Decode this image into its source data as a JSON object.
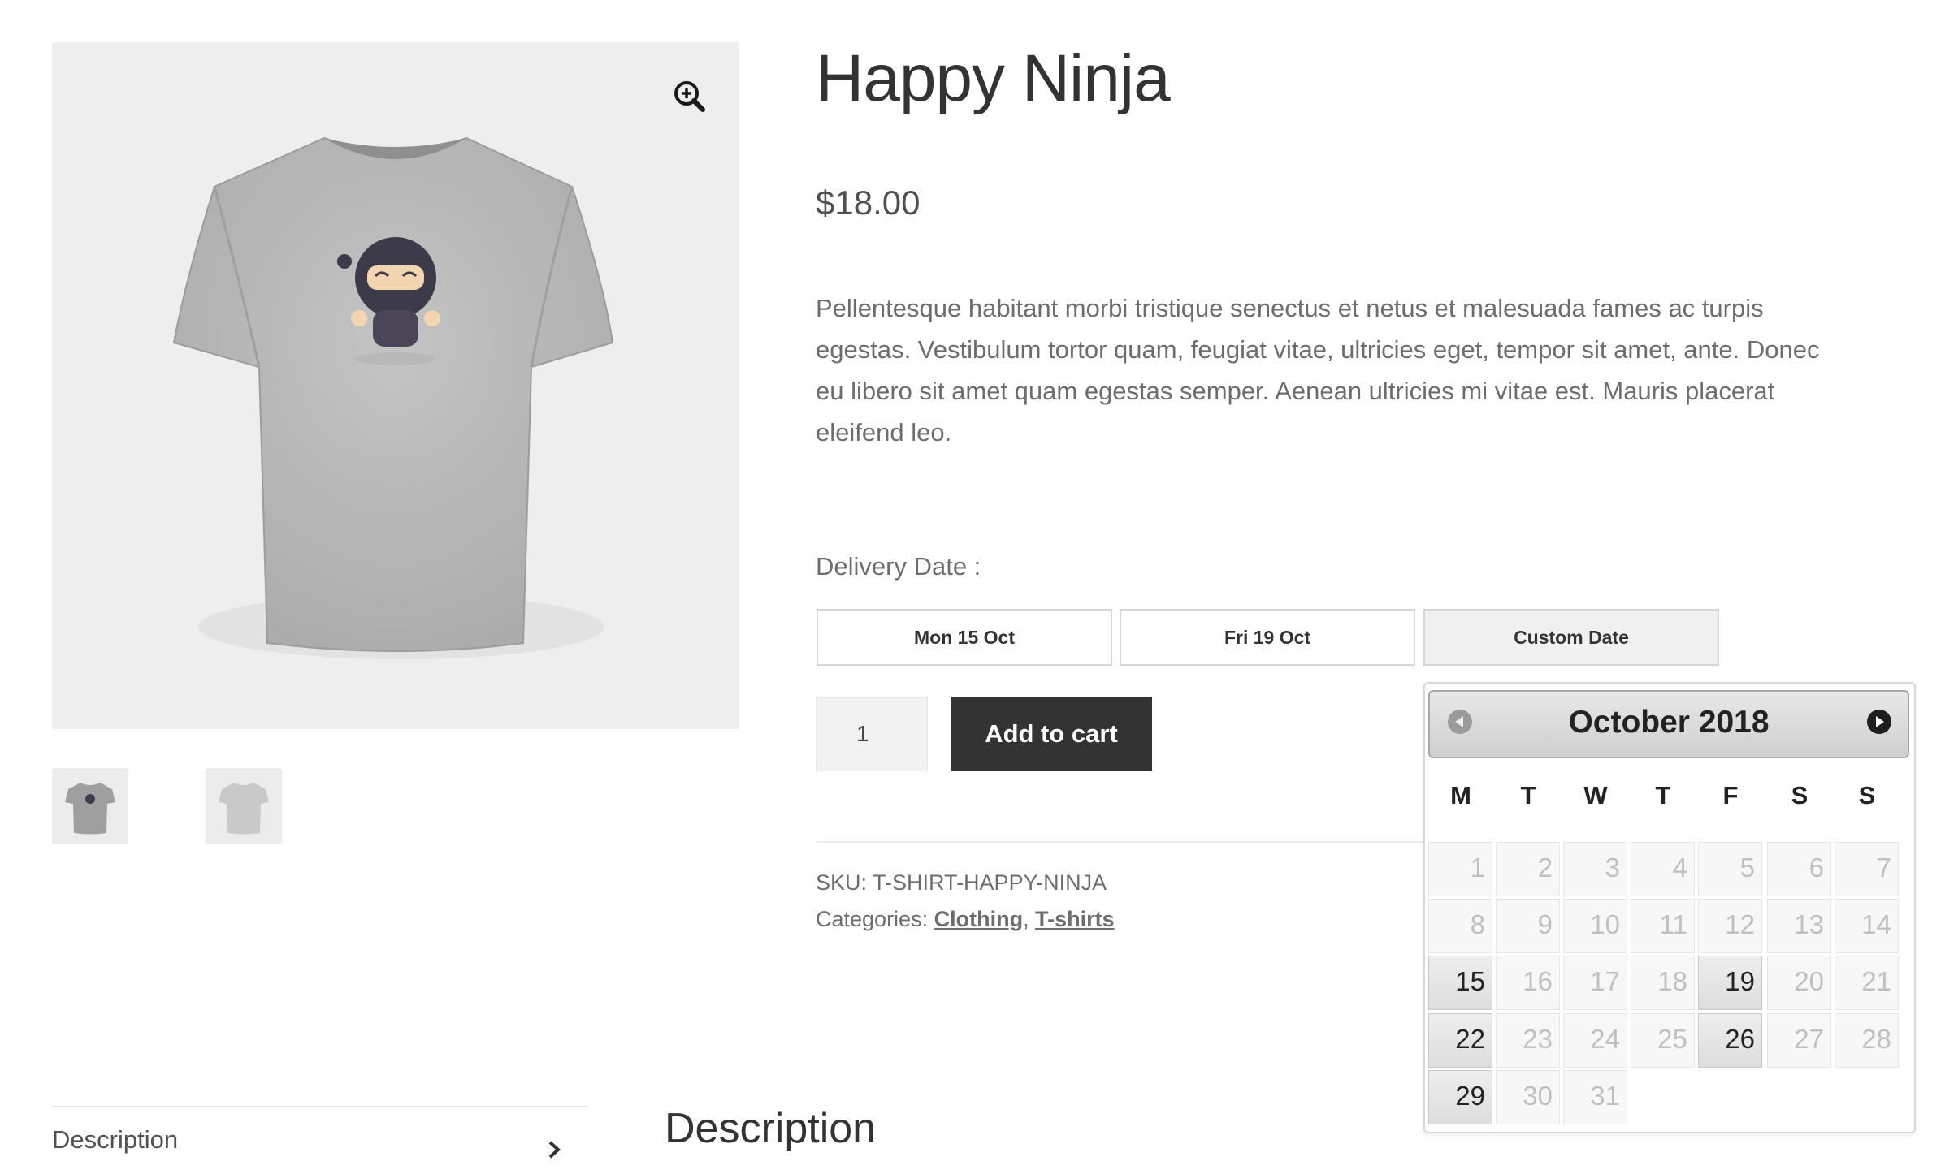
{
  "gallery": {
    "zoom_icon": "magnifier-plus-icon",
    "main_image_alt": "Happy Ninja t-shirt",
    "thumbnails": [
      "ninja-shirt-front-thumb",
      "shirt-back-thumb"
    ]
  },
  "product": {
    "title": "Happy Ninja",
    "price": "$18.00",
    "description": "Pellentesque habitant morbi tristique senectus et netus et malesuada fames ac turpis egestas. Vestibulum tortor quam, feugiat vitae, ultricies eget, tempor sit amet, ante. Donec eu libero sit amet quam egestas semper. Aenean ultricies mi vitae est. Mauris placerat eleifend leo."
  },
  "delivery": {
    "label": "Delivery Date :",
    "options": [
      "Mon 15 Oct",
      "Fri 19 Oct",
      "Custom Date"
    ],
    "selected": "Custom Date"
  },
  "cart": {
    "quantity": "1",
    "add_label": "Add to cart"
  },
  "meta": {
    "sku_label": "SKU:",
    "sku": "T-SHIRT-HAPPY-NINJA",
    "categories_label": "Categories:",
    "categories": [
      "Clothing",
      "T-shirts"
    ],
    "separator": ","
  },
  "tabs": {
    "items": [
      "Description"
    ],
    "heading": "Description",
    "chevron_icon": "chevron-right-icon"
  },
  "datepicker": {
    "title": "October 2018",
    "prev_icon": "prev-arrow-icon",
    "next_icon": "next-arrow-icon",
    "weekdays": [
      "M",
      "T",
      "W",
      "T",
      "F",
      "S",
      "S"
    ],
    "weeks": [
      [
        "1",
        "2",
        "3",
        "4",
        "5",
        "6",
        "7"
      ],
      [
        "8",
        "9",
        "10",
        "11",
        "12",
        "13",
        "14"
      ],
      [
        "15",
        "16",
        "17",
        "18",
        "19",
        "20",
        "21"
      ],
      [
        "22",
        "23",
        "24",
        "25",
        "26",
        "27",
        "28"
      ],
      [
        "29",
        "30",
        "31"
      ]
    ],
    "available_days": [
      "15",
      "19",
      "22",
      "26",
      "29"
    ]
  }
}
